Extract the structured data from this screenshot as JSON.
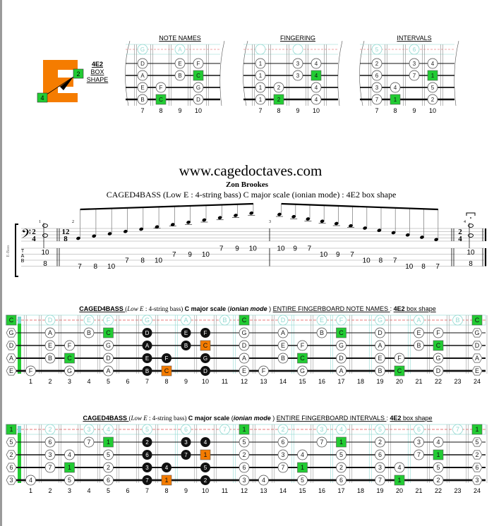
{
  "logo": {
    "letter": "E",
    "shape_code": "4E2",
    "line2": "BOX",
    "line3": "SHAPE",
    "root_marker": "2",
    "finger_marker": "4",
    "color": "#f57c00"
  },
  "colors": {
    "root_green": "#22cc33",
    "highlight_orange": "#f57c00",
    "open_string_cyan": "#8fd8d0",
    "dashed_red": "#e05050",
    "black_dot": "#111111"
  },
  "box_diagrams": [
    {
      "title": "NOTE NAMES",
      "frets": [
        "7",
        "8",
        "9",
        "10"
      ],
      "open_row": [
        "G",
        "",
        "A",
        ""
      ],
      "rows": [
        [
          "D",
          "",
          "E",
          "F"
        ],
        [
          "A",
          "",
          "B",
          "C"
        ],
        [
          "E",
          "F",
          "",
          "G"
        ],
        [
          "B",
          "C",
          "",
          "D"
        ]
      ],
      "roots": [
        [
          1,
          3
        ],
        [
          3,
          1
        ]
      ]
    },
    {
      "title": "FINGERING",
      "frets": [
        "7",
        "8",
        "9",
        "10"
      ],
      "open_row": [
        "",
        "",
        "",
        ""
      ],
      "rows": [
        [
          "1",
          "",
          "3",
          "4"
        ],
        [
          "1",
          "",
          "3",
          "4"
        ],
        [
          "1",
          "2",
          "",
          "4"
        ],
        [
          "1",
          "2",
          "",
          "4"
        ]
      ],
      "roots": [
        [
          1,
          3
        ],
        [
          3,
          1
        ]
      ]
    },
    {
      "title": "INTERVALS",
      "frets": [
        "7",
        "8",
        "9",
        "10"
      ],
      "open_row": [
        "5",
        "",
        "6",
        ""
      ],
      "rows": [
        [
          "2",
          "",
          "3",
          "4"
        ],
        [
          "6",
          "",
          "7",
          "1"
        ],
        [
          "3",
          "4",
          "",
          "5"
        ],
        [
          "7",
          "1",
          "",
          "2"
        ]
      ],
      "roots": [
        [
          1,
          3
        ],
        [
          3,
          1
        ]
      ]
    }
  ],
  "header": {
    "website": "www.cagedoctaves.com",
    "author": "Zon Brookes",
    "subtitle": "CAGED4BASS (Low E : 4-string bass) C major scale (ionian mode) : 4E2 box shape"
  },
  "notation": {
    "instrument_label": "E-Bass",
    "tab_letters": [
      "T",
      "A",
      "B"
    ],
    "time_sig_1": [
      "2",
      "4"
    ],
    "time_sig_2": [
      "12",
      "8"
    ],
    "time_sig_3": [
      "2",
      "4"
    ],
    "measure_numbers": [
      "1",
      "2",
      "3",
      "4"
    ],
    "measure1_tab": [
      {
        "top": "10",
        "bottom": "8"
      }
    ],
    "measure2_tab": [
      {
        "s": 4,
        "f": "7"
      },
      {
        "s": 4,
        "f": "8"
      },
      {
        "s": 4,
        "f": "10"
      },
      {
        "s": 3,
        "f": "7"
      },
      {
        "s": 3,
        "f": "8"
      },
      {
        "s": 3,
        "f": "10"
      },
      {
        "s": 2,
        "f": "7"
      },
      {
        "s": 2,
        "f": "9"
      },
      {
        "s": 2,
        "f": "10"
      },
      {
        "s": 1,
        "f": "7"
      },
      {
        "s": 1,
        "f": "9"
      },
      {
        "s": 1,
        "f": "10"
      }
    ],
    "measure3_tab": [
      {
        "s": 1,
        "f": "10"
      },
      {
        "s": 1,
        "f": "9"
      },
      {
        "s": 1,
        "f": "7"
      },
      {
        "s": 2,
        "f": "10"
      },
      {
        "s": 2,
        "f": "9"
      },
      {
        "s": 2,
        "f": "7"
      },
      {
        "s": 3,
        "f": "10"
      },
      {
        "s": 3,
        "f": "8"
      },
      {
        "s": 3,
        "f": "7"
      },
      {
        "s": 4,
        "f": "10"
      },
      {
        "s": 4,
        "f": "8"
      },
      {
        "s": 4,
        "f": "7"
      }
    ],
    "measure4_tab": [
      {
        "top": "10",
        "bottom": "8"
      }
    ]
  },
  "fingerboards": [
    {
      "title_brand": "CAGED4BASS",
      "title_paren_open": "(",
      "title_italic": "Low E",
      "title_rest": " : 4-string bass)",
      "title_scale": "C major scale",
      "title_mode_open": "(",
      "title_mode": "ionian mode",
      "title_mode_close": ")",
      "title_section": "ENTIRE FINGERBOARD  NOTE NAMES",
      "title_colon": ":",
      "title_shape": "4E2",
      "title_shape_suffix": "box shape",
      "fret_numbers": [
        "1",
        "2",
        "3",
        "4",
        "5",
        "6",
        "7",
        "8",
        "9",
        "10",
        "11",
        "12",
        "13",
        "14",
        "15",
        "16",
        "17",
        "18",
        "19",
        "20",
        "21",
        "22",
        "23",
        "24"
      ],
      "open_row": {
        "0": "C",
        "2": "D",
        "4": "E",
        "5": "F",
        "7": "G",
        "9": "A",
        "11": "B",
        "12": "C",
        "14": "D",
        "16": "E",
        "17": "F",
        "19": "G",
        "21": "A",
        "23": "B",
        "24": "C"
      },
      "open_root_frets": [
        0,
        12,
        24
      ],
      "strings": [
        {
          "open": "G",
          "notes": {
            "2": "A",
            "4": "B",
            "5": "C",
            "7": "D",
            "9": "E",
            "10": "F",
            "12": "G",
            "14": "A",
            "16": "B",
            "17": "C",
            "19": "D",
            "21": "E",
            "22": "F",
            "24": "G"
          }
        },
        {
          "open": "D",
          "notes": {
            "2": "E",
            "3": "F",
            "5": "G",
            "7": "A",
            "9": "B",
            "10": "C",
            "12": "D",
            "14": "E",
            "15": "F",
            "17": "G",
            "19": "A",
            "21": "B",
            "22": "C",
            "24": "D"
          }
        },
        {
          "open": "A",
          "notes": {
            "2": "B",
            "3": "C",
            "5": "D",
            "7": "E",
            "8": "F",
            "10": "G",
            "12": "A",
            "14": "B",
            "15": "C",
            "17": "D",
            "19": "E",
            "20": "F",
            "22": "G",
            "24": "A"
          }
        },
        {
          "open": "E",
          "notes": {
            "1": "F",
            "3": "G",
            "5": "A",
            "7": "B",
            "8": "C",
            "10": "D",
            "12": "E",
            "13": "F",
            "15": "G",
            "17": "A",
            "19": "B",
            "20": "C",
            "22": "D",
            "24": "E"
          }
        }
      ],
      "roots": [
        [
          0,
          5
        ],
        [
          0,
          17
        ],
        [
          1,
          22
        ],
        [
          2,
          3
        ],
        [
          2,
          15
        ],
        [
          3,
          20
        ]
      ],
      "black": [
        [
          0,
          7
        ],
        [
          0,
          9
        ],
        [
          0,
          10
        ],
        [
          1,
          7
        ],
        [
          1,
          9
        ],
        [
          2,
          7
        ],
        [
          2,
          8
        ],
        [
          2,
          10
        ],
        [
          3,
          7
        ],
        [
          3,
          10
        ]
      ],
      "orange": [
        [
          1,
          10
        ],
        [
          3,
          8
        ]
      ]
    },
    {
      "title_brand": "CAGED4BASS",
      "title_paren_open": "(",
      "title_italic": "Low E",
      "title_rest": " : 4-string bass)",
      "title_scale": "C major scale",
      "title_mode_open": "(",
      "title_mode": "ionian mode",
      "title_mode_close": ")",
      "title_section": "ENTIRE FINGERBOARD  INTERVALS",
      "title_colon": ":",
      "title_shape": "4E2",
      "title_shape_suffix": "box shape",
      "fret_numbers": [
        "1",
        "2",
        "3",
        "4",
        "5",
        "6",
        "7",
        "8",
        "9",
        "10",
        "11",
        "12",
        "13",
        "14",
        "15",
        "16",
        "17",
        "18",
        "19",
        "20",
        "21",
        "22",
        "23",
        "24"
      ],
      "open_row": {
        "0": "1",
        "2": "2",
        "4": "3",
        "5": "4",
        "7": "5",
        "9": "6",
        "11": "7",
        "12": "1",
        "14": "2",
        "16": "3",
        "17": "4",
        "19": "5",
        "21": "6",
        "23": "7",
        "24": "1"
      },
      "open_root_frets": [
        0,
        12,
        24
      ],
      "strings": [
        {
          "open": "5",
          "notes": {
            "2": "6",
            "4": "7",
            "5": "1",
            "7": "2",
            "9": "3",
            "10": "4",
            "12": "5",
            "14": "6",
            "16": "7",
            "17": "1",
            "19": "2",
            "21": "3",
            "22": "4",
            "24": "5"
          }
        },
        {
          "open": "2",
          "notes": {
            "2": "3",
            "3": "4",
            "5": "5",
            "7": "6",
            "9": "7",
            "10": "1",
            "12": "2",
            "14": "3",
            "15": "4",
            "17": "5",
            "19": "6",
            "21": "7",
            "22": "1",
            "24": "2"
          }
        },
        {
          "open": "6",
          "notes": {
            "2": "7",
            "3": "1",
            "5": "2",
            "7": "3",
            "8": "4",
            "10": "5",
            "12": "6",
            "14": "7",
            "15": "1",
            "17": "2",
            "19": "3",
            "20": "4",
            "22": "5",
            "24": "6"
          }
        },
        {
          "open": "3",
          "notes": {
            "1": "4",
            "3": "5",
            "5": "6",
            "7": "7",
            "8": "1",
            "10": "2",
            "12": "3",
            "13": "4",
            "15": "5",
            "17": "6",
            "19": "7",
            "20": "1",
            "22": "2",
            "24": "3"
          }
        }
      ],
      "roots": [
        [
          0,
          5
        ],
        [
          0,
          17
        ],
        [
          1,
          22
        ],
        [
          2,
          3
        ],
        [
          2,
          15
        ],
        [
          3,
          20
        ]
      ],
      "black": [
        [
          0,
          7
        ],
        [
          0,
          9
        ],
        [
          0,
          10
        ],
        [
          1,
          7
        ],
        [
          1,
          9
        ],
        [
          2,
          7
        ],
        [
          2,
          8
        ],
        [
          2,
          10
        ],
        [
          3,
          7
        ],
        [
          3,
          10
        ]
      ],
      "orange": [
        [
          1,
          10
        ],
        [
          3,
          8
        ]
      ]
    }
  ]
}
